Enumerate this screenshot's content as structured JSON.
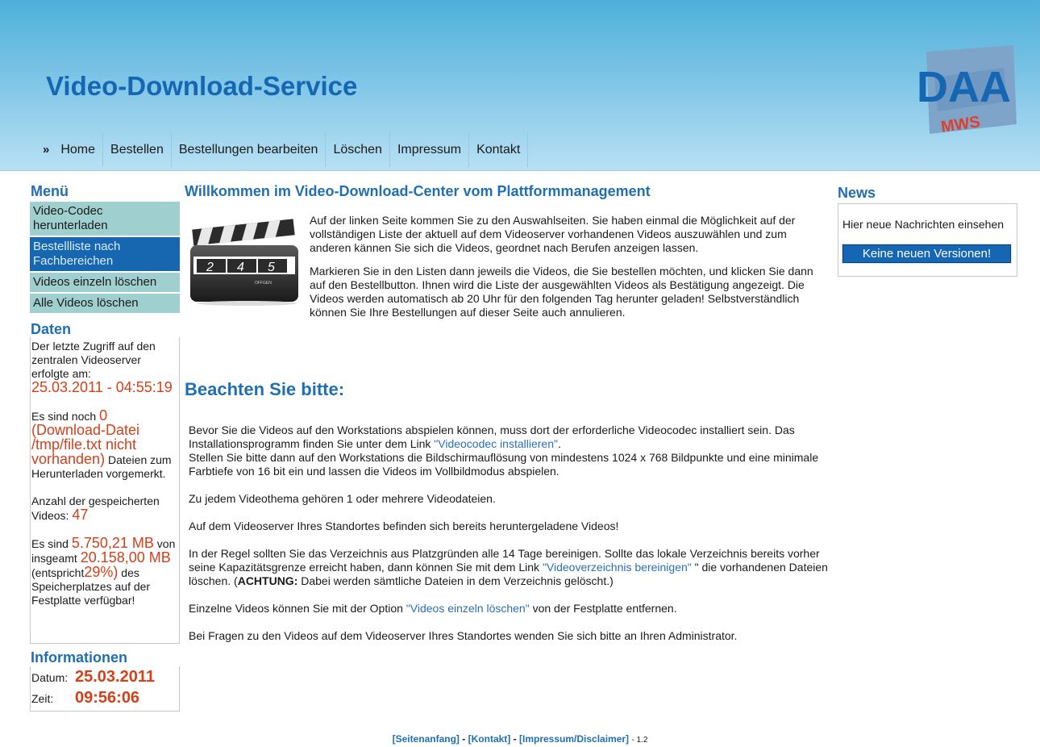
{
  "header": {
    "title": "Video-Download-Service",
    "logo_text": "DAA",
    "logo_sub": "MWS"
  },
  "nav": {
    "arrow": "»",
    "items": [
      "Home",
      "Bestellen",
      "Bestellungen bearbeiten",
      "Löschen",
      "Impressum",
      "Kontakt"
    ]
  },
  "sidebar": {
    "menu_heading": "Menü",
    "menu_items": [
      {
        "label": "Video-Codec herunterladen",
        "active": false
      },
      {
        "label": "Bestellliste nach Fachbereichen",
        "active": true
      },
      {
        "label": "Videos einzeln löschen",
        "active": false
      },
      {
        "label": "Alle Videos löschen",
        "active": false
      }
    ],
    "daten_heading": "Daten",
    "last_access_text": "Der letzte Zugriff auf den zentralen Videoserver erfolgte am:",
    "last_access_value": "25.03.2011 - 04:55:19",
    "queued_prefix": "Es sind noch",
    "queued_count": "0",
    "queued_error": "(Download-Datei /tmp/file.txt nicht vorhanden)",
    "queued_suffix": "Dateien zum Herunterladen vorgemerkt.",
    "stored_prefix": "Anzahl der gespeicherten Videos:",
    "stored_count": "47",
    "space_prefix": "Es sind",
    "space_free": "5.750,21 MB",
    "space_mid": "von insgeamt",
    "space_total": "20.158,00 MB",
    "space_pct_prefix": "(entspricht",
    "space_pct": "29%)",
    "space_suffix": "des Speicherplatzes auf der Festplatte verfügbar!",
    "info_heading": "Informationen",
    "date_label": "Datum:",
    "date_value": "25.03.2011",
    "time_label": "Zeit:",
    "time_value": "09:56:06"
  },
  "main": {
    "heading": "Willkommen im Video-Download-Center vom Plattformmanagement",
    "clapper_digits": [
      "2",
      "4",
      "5"
    ],
    "clapper_small": "OFFGEN",
    "intro_p1": "Auf der linken Seite kommen Sie zu den Auswahlseiten. Sie haben einmal die Möglichkeit auf der vollständigen Liste der aktuell auf dem Videoserver vorhandenen Videos auszuwählen und zum anderen kännen Sie sich die Videos, geordnet nach Berufen anzeigen lassen.",
    "intro_p2": "Markieren Sie in den Listen dann jeweils die Videos, die Sie bestellen möchten, und klicken Sie dann auf den Bestellbutton. Ihnen wird die Liste der ausgewählten Videos als Bestätigung angezeigt. Die Videos werden automatisch ab 20 Uhr für den folgenden Tag herunter geladen! Selbstverständlich können Sie Ihre Bestellungen auf dieser Seite auch annulieren.",
    "note_heading": "Beachten Sie bitte:",
    "n1_a": "Bevor Sie die Videos auf den Workstations abspielen können, muss dort der erforderliche Videocodec installiert sein. Das Installationsprogramm finden Sie unter dem Link",
    "n1_link": "\"Videocodec installieren\"",
    "n1_b": ".",
    "n1_c": "Stellen Sie bitte dann auf den Workstations die Bildschirmauflösung von mindestens 1024 x 768 Bildpunkte und eine minimale Farbtiefe von 16 bit ein und lassen die Videos im Vollbildmodus abspielen.",
    "n2": "Zu jedem Videothema gehören 1 oder mehrere Videodateien.",
    "n3": "Auf dem Videoserver Ihres Standortes befinden sich bereits heruntergeladene Videos!",
    "n4_a": "In der Regel sollten Sie das Verzeichnis aus Platzgründen alle 14 Tage bereinigen. Sollte das lokale Verzeichnis bereits vorher seine Kapazitätsgrenze erreicht haben, dann können Sie mit dem Link",
    "n4_link": "\"Videoverzeichnis bereinigen\"",
    "n4_b": "\" die vorhandenen Dateien löschen. (",
    "n4_bold": "ACHTUNG:",
    "n4_c": "Dabei werden sämtliche Dateien in dem Verzeichnis gelöscht.)",
    "n5_a": "Einzelne Videos können Sie mit der Option",
    "n5_link": "\"Videos einzeln löschen\"",
    "n5_b": "von der Festplatte entfernen.",
    "n6": "Bei Fragen zu den Videos auf dem Videoserver Ihres Standortes wenden Sie sich bitte an Ihren Administrator."
  },
  "news": {
    "heading": "News",
    "text": "Hier neue Nachrichten einsehen",
    "button": "Keine neuen Versionen!"
  },
  "footer": {
    "link_top": "[Seitenanfang]",
    "sep": "-",
    "link_contact": "[Kontakt]",
    "link_imprint": "[Impressum/Disclaimer]",
    "version": "- 1.2"
  },
  "colors": {
    "accent_blue": "#1f6fb2",
    "highlight_red": "#d4401a",
    "menu_teal": "#9fd0cf",
    "menu_active": "#1667b0"
  }
}
